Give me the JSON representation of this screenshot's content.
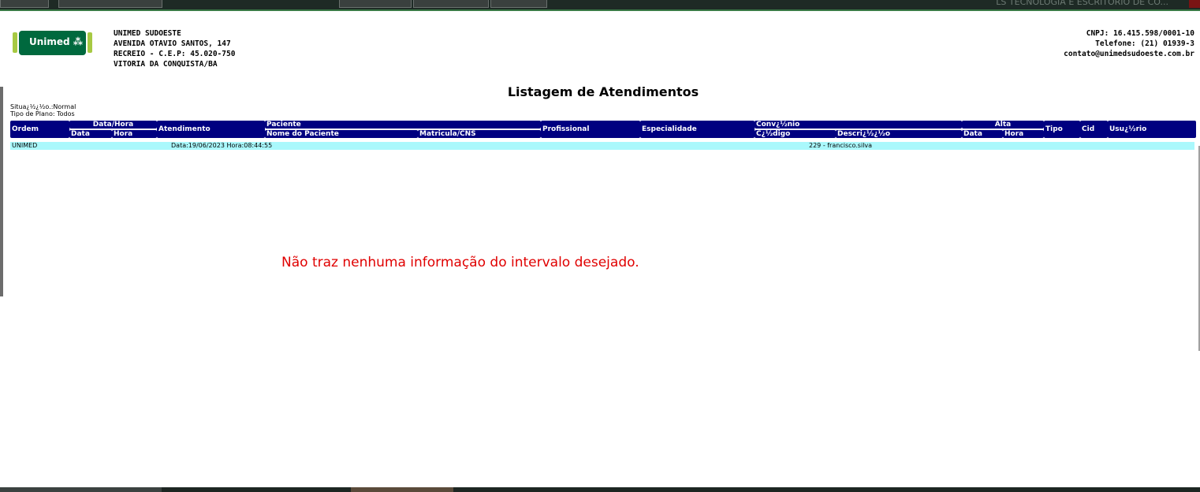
{
  "window": {
    "title": "LS TECNOLOGIA E ESCRITORIO DE CO..."
  },
  "logo": {
    "text": "Unimed ⁂"
  },
  "company": {
    "name": "UNIMED SUDOESTE",
    "address": "AVENIDA OTAVIO SANTOS, 147",
    "district": "RECREIO - C.E.P: 45.020-750",
    "city": "VITORIA DA CONQUISTA/BA"
  },
  "contact": {
    "cnpj": "CNPJ: 16.415.598/0001-10",
    "phone": "Telefone: (21) 01939-3",
    "email": "contato@unimedsudoeste.com.br"
  },
  "report": {
    "title": "Listagem de Atendimentos",
    "situacao": "Situa¿½¿½o.:Normal",
    "tipo_plano": "Tipo de Plano: Todos"
  },
  "table": {
    "headers": {
      "ordem": "Ordem",
      "data_hora": "Data/Hora",
      "data": "Data",
      "hora": "Hora",
      "atendimento": "Atendimento",
      "paciente": "Paciente",
      "nome_paciente": "Nome do Paciente",
      "matricula": "Matricula/CNS",
      "profissional": "Profissional",
      "especialidade": "Especialidade",
      "convenio": "Conv¿½nio",
      "codigo": "C¿½digo",
      "descricao": "Descri¿½¿½o",
      "alta": "Alta",
      "alta_data": "Data",
      "alta_hora": "Hora",
      "tipo": "Tipo",
      "cid": "Cid",
      "usuario": "Usu¿½rio"
    },
    "row": {
      "ordem": "UNIMED",
      "atendimento": "Data:19/06/2023 Hora:08:44:55",
      "usuario": "229 - francisco.silva"
    }
  },
  "annotation": "Não traz nenhuma informação do intervalo desejado."
}
